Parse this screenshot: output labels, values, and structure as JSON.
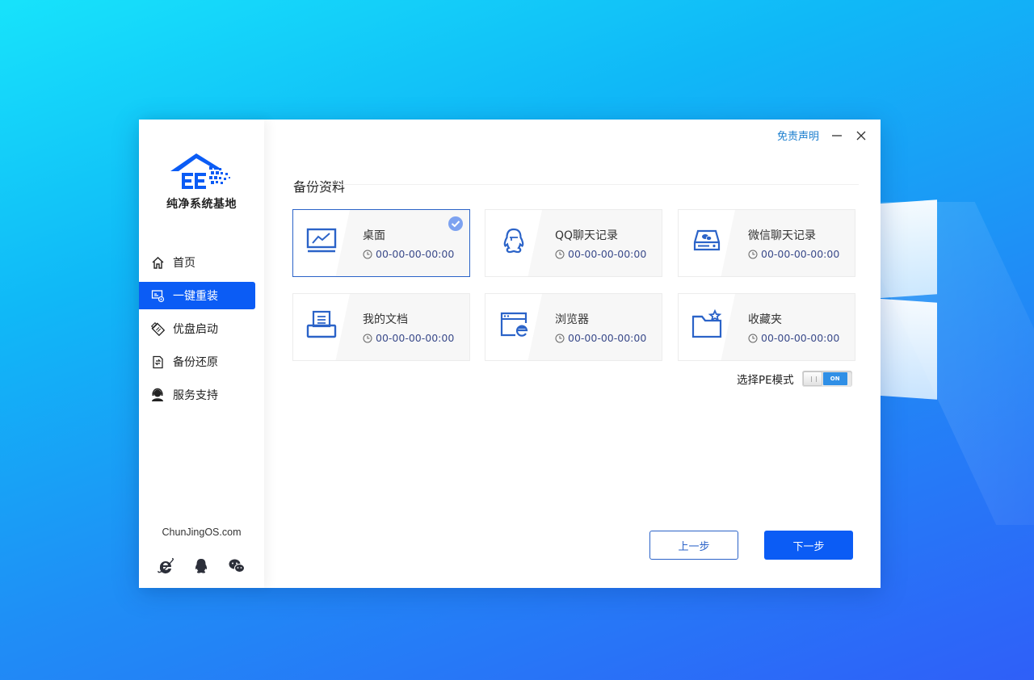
{
  "app": {
    "logo_text": "纯净系统基地",
    "website": "ChunJingOS.com"
  },
  "topbar": {
    "disclaimer": "免责声明"
  },
  "sidebar": {
    "items": [
      {
        "label": "首页",
        "icon": "home-icon",
        "active": false
      },
      {
        "label": "一键重装",
        "icon": "reinstall-icon",
        "active": true
      },
      {
        "label": "优盘启动",
        "icon": "usb-icon",
        "active": false
      },
      {
        "label": "备份还原",
        "icon": "backup-icon",
        "active": false
      },
      {
        "label": "服务支持",
        "icon": "support-icon",
        "active": false
      }
    ]
  },
  "main": {
    "section_title": "备份资料",
    "cards": [
      {
        "name": "桌面",
        "time": "00-00-00-00:00",
        "icon": "desktop-icon",
        "selected": true
      },
      {
        "name": "QQ聊天记录",
        "time": "00-00-00-00:00",
        "icon": "qq-icon",
        "selected": false
      },
      {
        "name": "微信聊天记录",
        "time": "00-00-00-00:00",
        "icon": "wechat-drive-icon",
        "selected": false
      },
      {
        "name": "我的文档",
        "time": "00-00-00-00:00",
        "icon": "document-icon",
        "selected": false
      },
      {
        "name": "浏览器",
        "time": "00-00-00-00:00",
        "icon": "browser-icon",
        "selected": false
      },
      {
        "name": "收藏夹",
        "time": "00-00-00-00:00",
        "icon": "favorites-folder-icon",
        "selected": false
      }
    ],
    "pe_mode": {
      "label": "选择PE模式",
      "state": "ON"
    },
    "buttons": {
      "prev": "上一步",
      "next": "下一步"
    }
  },
  "colors": {
    "accent": "#0b5cf5",
    "icon": "#2b63c8",
    "link": "#1d7fcf"
  }
}
